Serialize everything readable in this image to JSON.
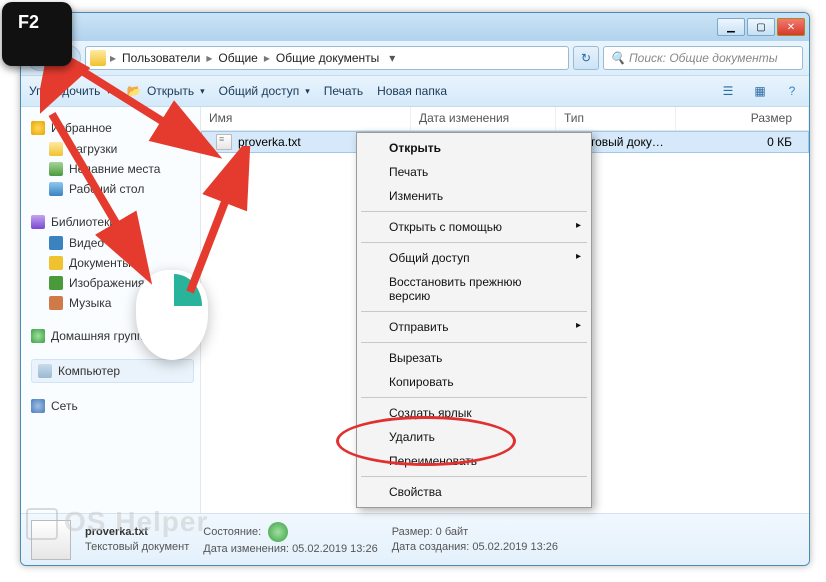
{
  "keycap": "F2",
  "titlebar": {},
  "breadcrumb": {
    "items": [
      "Пользователи",
      "Общие",
      "Общие документы"
    ]
  },
  "search": {
    "placeholder": "Поиск: Общие документы"
  },
  "toolbar": {
    "organize": "Упорядочить",
    "open": "Открыть",
    "share": "Общий доступ",
    "print": "Печать",
    "newfolder": "Новая папка"
  },
  "sidebar": {
    "favorites": "Избранное",
    "downloads": "Загрузки",
    "recent": "Недавние места",
    "desktop": "Рабочий стол",
    "libraries": "Библиотеки",
    "video": "Видео",
    "documents": "Документы",
    "images": "Изображения",
    "music": "Музыка",
    "homegroup": "Домашняя группа",
    "computer": "Компьютер",
    "network": "Сеть"
  },
  "columns": {
    "name": "Имя",
    "date": "Дата изменения",
    "type": "Тип",
    "size": "Размер"
  },
  "files": [
    {
      "name": "proverka.txt",
      "date": "",
      "type": "Текстовый докум...",
      "size": "0 КБ"
    }
  ],
  "context_menu": {
    "open": "Открыть",
    "print": "Печать",
    "edit": "Изменить",
    "openwith": "Открыть с помощью",
    "share": "Общий доступ",
    "restore": "Восстановить прежнюю версию",
    "sendto": "Отправить",
    "cut": "Вырезать",
    "copy": "Копировать",
    "shortcut": "Создать ярлык",
    "delete": "Удалить",
    "rename": "Переименовать",
    "properties": "Свойства"
  },
  "details": {
    "filename": "proverka.txt",
    "filetype": "Текстовый документ",
    "state_label": "Состояние:",
    "mtime_label": "Дата изменения:",
    "mtime": "05.02.2019 13:26",
    "size_label": "Размер:",
    "size": "0 байт",
    "ctime_label": "Дата создания:",
    "ctime": "05.02.2019 13:26"
  },
  "watermark": "OS Helper"
}
